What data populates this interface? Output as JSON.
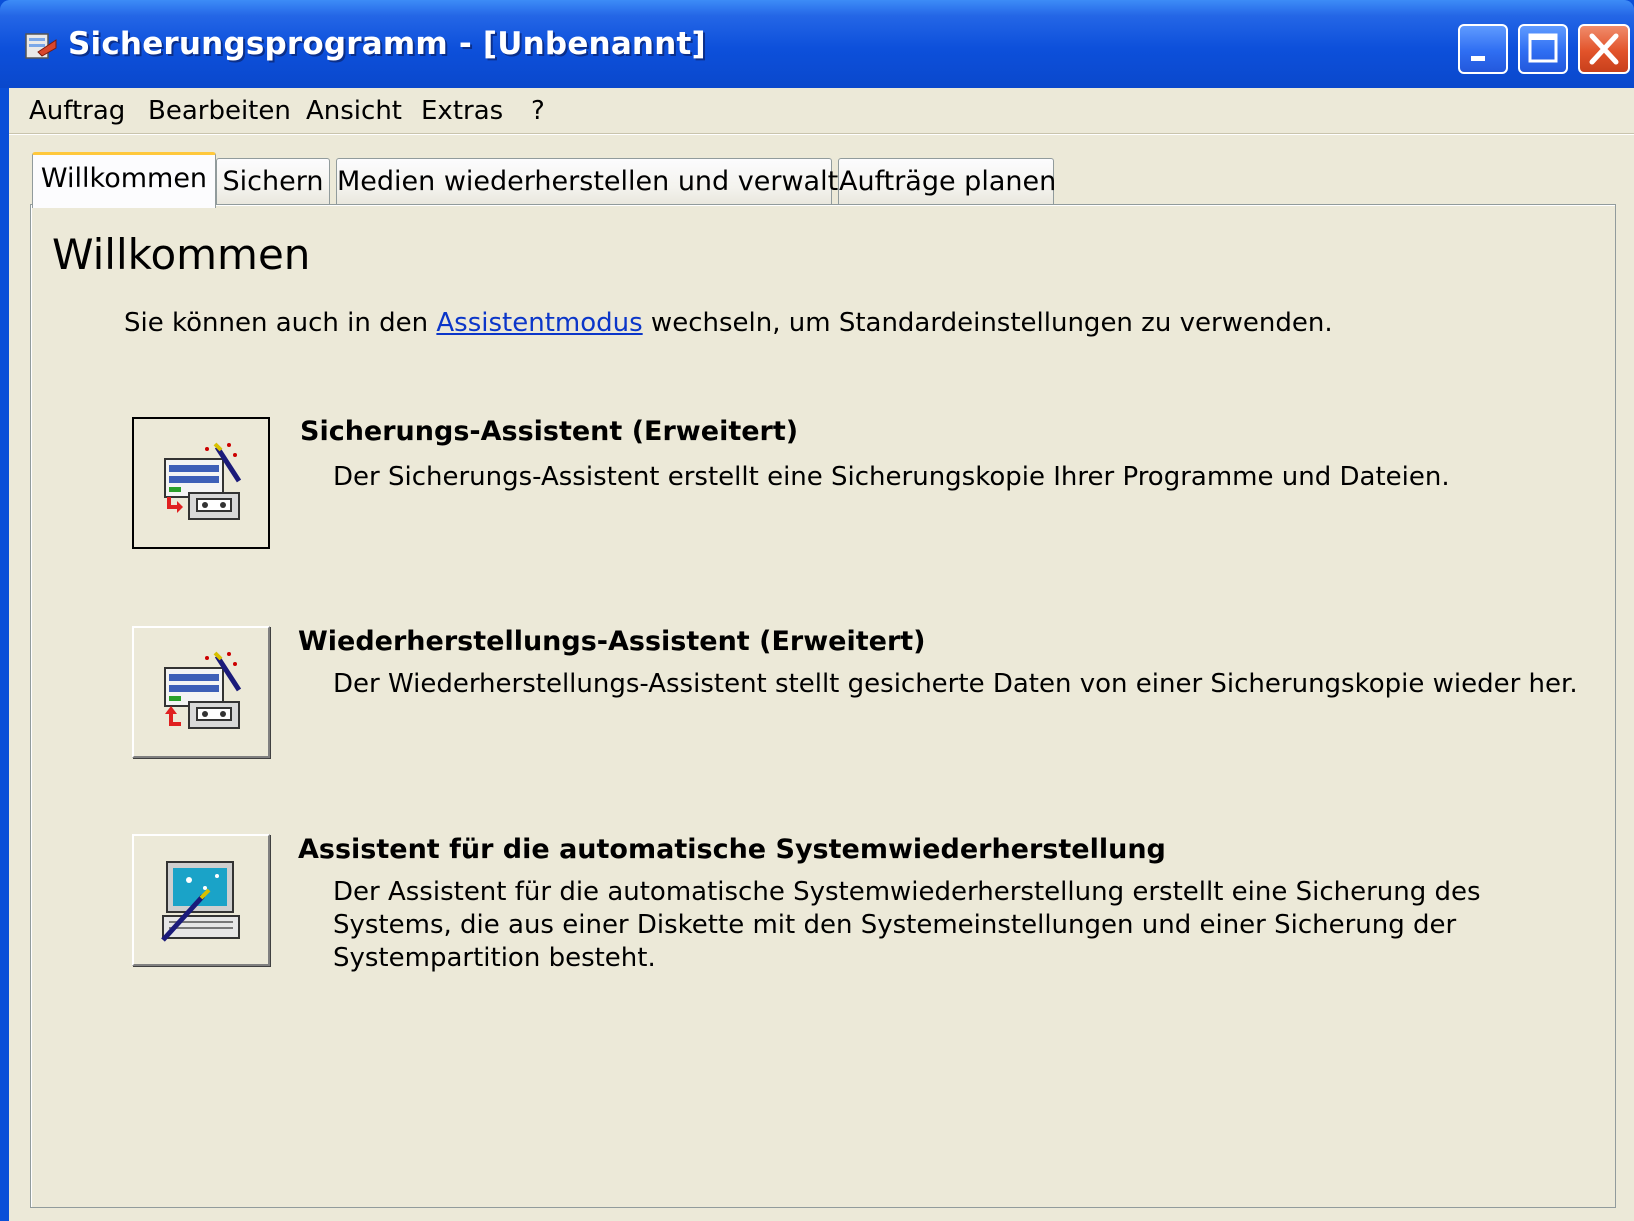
{
  "window": {
    "title": "Sicherungsprogramm - [Unbenannt]"
  },
  "menubar": {
    "items": [
      "Auftrag",
      "Bearbeiten",
      "Ansicht",
      "Extras",
      "?"
    ]
  },
  "tabs": [
    {
      "label": "Willkommen",
      "active": true
    },
    {
      "label": "Sichern",
      "active": false
    },
    {
      "label": "Medien wiederherstellen und verwalten",
      "active": false
    },
    {
      "label": "Aufträge planen",
      "active": false
    }
  ],
  "welcome": {
    "heading": "Willkommen",
    "intro_before": "Sie können auch in den ",
    "intro_link": "Assistentmodus",
    "intro_after": " wechseln, um Standardeinstellungen zu verwenden."
  },
  "wizards": [
    {
      "title": "Sicherungs-Assistent (Erweitert)",
      "description": "Der Sicherungs-Assistent erstellt eine Sicherungskopie Ihrer Programme und Dateien.",
      "icon": "backup-wizard-icon"
    },
    {
      "title": "Wiederherstellungs-Assistent (Erweitert)",
      "description": "Der Wiederherstellungs-Assistent stellt gesicherte Daten von einer Sicherungskopie wieder her.",
      "icon": "restore-wizard-icon"
    },
    {
      "title": "Assistent für die automatische Systemwiederherstellung",
      "description": "Der Assistent für die automatische Systemwiederherstellung erstellt eine Sicherung des Systems, die aus einer Diskette mit den Systemeinstellungen und einer Sicherung der Systempartition besteht.",
      "icon": "asr-wizard-icon"
    }
  ],
  "colors": {
    "titlebar": "#0a4fd8",
    "client_bg": "#ece9d8",
    "link": "#0b36c9",
    "active_tab_accent": "#ffc83c",
    "close_button": "#e2532a"
  }
}
